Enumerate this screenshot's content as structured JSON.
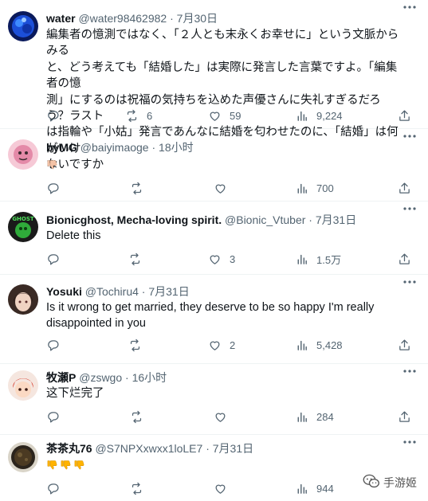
{
  "tweets": [
    {
      "name": "water",
      "handle": "@water98462982",
      "sep": "·",
      "time": "7月30日",
      "lines": [
        "編集者の憶測ではなく、「２人とも末永くお幸せに」という文脈からみる",
        "と、どう考えても「結婚した」は実際に発言した言葉ですよ。「編集者の憶",
        "測」にするのは祝福の気持ちを込めた声優さんに失礼すぎるだろう？ラスト",
        "は指輪や「小姑」発言であんなに結婚を匂わせたのに、「結婚」は何がいけ",
        "ないですか"
      ],
      "replies": "",
      "retweets": "6",
      "likes": "59",
      "views": "9,224"
    },
    {
      "name": "byMG",
      "handle": "@baiyimaoge",
      "sep": "·",
      "time": "18小时",
      "emoji": [
        "thumbs-down"
      ],
      "replies": "",
      "retweets": "",
      "likes": "",
      "views": "700"
    },
    {
      "name": "Bionicghost, Mecha-loving spirit.",
      "handle": "@Bionic_Vtuber",
      "sep": "·",
      "time": "7月31日",
      "avatar_text": "GHOST",
      "lines": [
        "Delete this"
      ],
      "replies": "",
      "retweets": "",
      "likes": "3",
      "views": "1.5万"
    },
    {
      "name": "Yosuki",
      "handle": "@Tochiru4",
      "sep": "·",
      "time": "7月31日",
      "lines": [
        "Is it wrong to get married, they deserve to be so happy I'm really",
        "disappointed in you"
      ],
      "replies": "",
      "retweets": "",
      "likes": "2",
      "views": "5,428"
    },
    {
      "name": "牧瀬P",
      "handle": "@zswgo",
      "sep": "·",
      "time": "16小时",
      "lines": [
        "这下烂完了"
      ],
      "replies": "",
      "retweets": "",
      "likes": "",
      "views": "284"
    },
    {
      "name": "茶茶丸76",
      "handle": "@S7NPXxwxx1loLE7",
      "sep": "·",
      "time": "7月31日",
      "emoji": [
        "thumbs-down",
        "thumbs-down",
        "thumbs-down"
      ],
      "replies": "",
      "retweets": "",
      "likes": "",
      "views": "944"
    }
  ],
  "watermark": "手游姬",
  "icons": [
    "reply-icon",
    "retweet-icon",
    "like-icon",
    "views-icon",
    "share-icon",
    "more-icon",
    "thumbs-down-icon",
    "wechat-icon"
  ],
  "colors": {
    "text": "#0f1419",
    "secondary": "#536471",
    "divider": "#eff3f4",
    "thumb": "#ffb300"
  }
}
